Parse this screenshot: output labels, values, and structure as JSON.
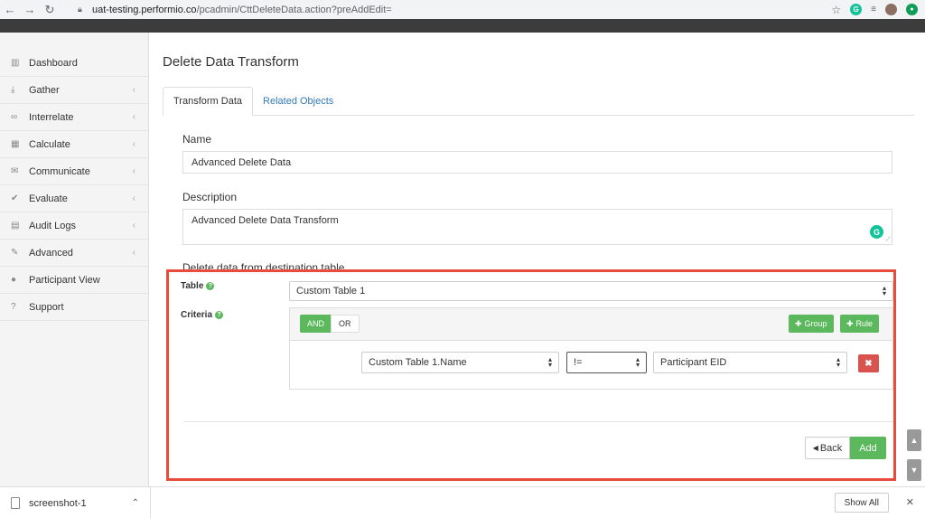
{
  "browser": {
    "url_host": "uat-testing.performio.co",
    "url_path": "/pcadmin/CttDeleteData.action?preAddEdit="
  },
  "sidebar": {
    "items": [
      {
        "label": "Dashboard",
        "icon": "bar-chart-icon",
        "glyph": "▥",
        "chevron": false
      },
      {
        "label": "Gather",
        "icon": "download-icon",
        "glyph": "⤓",
        "chevron": true
      },
      {
        "label": "Interrelate",
        "icon": "link-icon",
        "glyph": "∞",
        "chevron": true
      },
      {
        "label": "Calculate",
        "icon": "table-icon",
        "glyph": "▦",
        "chevron": true
      },
      {
        "label": "Communicate",
        "icon": "comments-icon",
        "glyph": "✉",
        "chevron": true
      },
      {
        "label": "Evaluate",
        "icon": "thumbs-up-icon",
        "glyph": "✔",
        "chevron": true
      },
      {
        "label": "Audit Logs",
        "icon": "file-icon",
        "glyph": "▤",
        "chevron": true
      },
      {
        "label": "Advanced",
        "icon": "wrench-icon",
        "glyph": "✎",
        "chevron": true
      },
      {
        "label": "Participant View",
        "icon": "user-icon",
        "glyph": "●",
        "chevron": false
      },
      {
        "label": "Support",
        "icon": "question-circle-icon",
        "glyph": "?",
        "chevron": false
      }
    ]
  },
  "main": {
    "title": "Delete Data Transform",
    "tabs": [
      {
        "label": "Transform Data",
        "active": true
      },
      {
        "label": "Related Objects",
        "active": false
      }
    ],
    "name_label": "Name",
    "name_value": "Advanced Delete Data",
    "description_label": "Description",
    "description_value": "Advanced Delete Data Transform",
    "section_label": "Delete data from destination table",
    "table_label": "Table",
    "table_value": "Custom Table 1",
    "criteria_label": "Criteria",
    "and_label": "AND",
    "or_label": "OR",
    "group_label": "Group",
    "rule_label": "Rule",
    "rule": {
      "field": "Custom Table 1.Name",
      "operator": "!=",
      "value": "Participant EID"
    },
    "back_label": "Back",
    "add_label": "Add"
  },
  "download_bar": {
    "file_name": "screenshot-1",
    "show_all_label": "Show All"
  },
  "colors": {
    "accent_green": "#5cb85c",
    "danger_red": "#d9534f",
    "highlight_red": "#e74c3c",
    "link_blue": "#337ab7"
  }
}
